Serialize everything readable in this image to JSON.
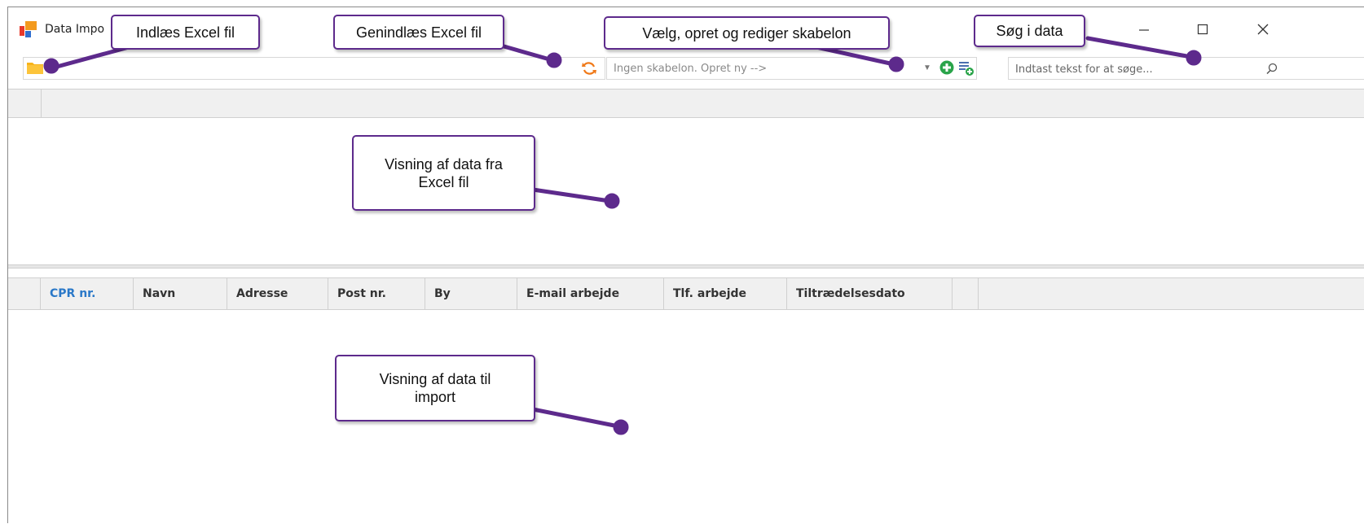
{
  "window": {
    "title": "Data Impo",
    "controls": {
      "minimize": "–",
      "maximize": "☐",
      "close": "✕"
    }
  },
  "toolbar": {
    "template_placeholder": "Ingen skabelon. Opret ny -->",
    "search_placeholder": "Indtast tekst for at søge..."
  },
  "import_grid": {
    "columns": [
      "CPR nr.",
      "Navn",
      "Adresse",
      "Post nr.",
      "By",
      "E-mail arbejde",
      "Tlf. arbejde",
      "Tiltrædelsesdato"
    ],
    "active_column": "CPR nr."
  },
  "callouts": {
    "load_excel": "Indlæs Excel fil",
    "reload_excel": "Genindlæs Excel fil",
    "template": "Vælg, opret og rediger skabelon",
    "search": "Søg i data",
    "excel_view_line1": "Visning af data fra",
    "excel_view_line2": "Excel fil",
    "import_view_line1": "Visning af data til",
    "import_view_line2": "import"
  },
  "colors": {
    "callout_border": "#5d2a8c",
    "active_column": "#2a78c8",
    "folder": "#f7b31a",
    "reload": "#f07a1a",
    "add": "#2aa44a"
  }
}
